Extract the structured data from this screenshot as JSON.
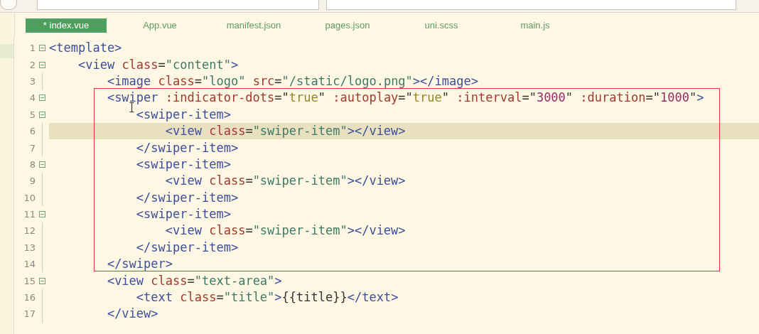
{
  "tabs": [
    {
      "label": "* index.vue",
      "selected": true
    },
    {
      "label": "App.vue",
      "selected": false
    },
    {
      "label": "manifest.json",
      "selected": false
    },
    {
      "label": "pages.json",
      "selected": false
    },
    {
      "label": "uni.scss",
      "selected": false
    },
    {
      "label": "main.js",
      "selected": false
    }
  ],
  "editor": {
    "lines": [
      {
        "number": "1",
        "kind": "open",
        "current": false,
        "tokens": [
          {
            "kind": "tag",
            "text": "<template>"
          }
        ]
      },
      {
        "number": "2",
        "kind": "open",
        "current": false,
        "tokens": [
          {
            "kind": "tag",
            "text": "    <view"
          },
          {
            "kind": "attr",
            "text": " class"
          },
          {
            "kind": "plain",
            "text": "="
          },
          {
            "kind": "str",
            "text": "\"content\""
          },
          {
            "kind": "tag",
            "text": ">"
          }
        ]
      },
      {
        "number": "3",
        "kind": "line",
        "current": false,
        "tokens": [
          {
            "kind": "tag",
            "text": "        <image"
          },
          {
            "kind": "attr",
            "text": " class"
          },
          {
            "kind": "plain",
            "text": "="
          },
          {
            "kind": "str",
            "text": "\"logo\""
          },
          {
            "kind": "attr",
            "text": " src"
          },
          {
            "kind": "plain",
            "text": "="
          },
          {
            "kind": "str",
            "text": "\"/static/logo.png\""
          },
          {
            "kind": "tag",
            "text": "></image>"
          }
        ]
      },
      {
        "number": "4",
        "kind": "open",
        "current": false,
        "tokens": [
          {
            "kind": "tag",
            "text": "        <swiper"
          },
          {
            "kind": "attr",
            "text": " :indicator-dots"
          },
          {
            "kind": "plain",
            "text": "=\""
          },
          {
            "kind": "bool",
            "text": "true"
          },
          {
            "kind": "plain",
            "text": "\" "
          },
          {
            "kind": "attr",
            "text": ":autoplay"
          },
          {
            "kind": "plain",
            "text": "=\""
          },
          {
            "kind": "bool",
            "text": "true"
          },
          {
            "kind": "plain",
            "text": "\" "
          },
          {
            "kind": "attr",
            "text": ":interval"
          },
          {
            "kind": "plain",
            "text": "=\""
          },
          {
            "kind": "num",
            "text": "3000"
          },
          {
            "kind": "plain",
            "text": "\" "
          },
          {
            "kind": "attr",
            "text": ":duration"
          },
          {
            "kind": "plain",
            "text": "=\""
          },
          {
            "kind": "num",
            "text": "1000"
          },
          {
            "kind": "plain",
            "text": "\""
          },
          {
            "kind": "tag",
            "text": ">"
          }
        ]
      },
      {
        "number": "5",
        "kind": "open",
        "current": false,
        "tokens": [
          {
            "kind": "tag",
            "text": "            <swiper-item>"
          }
        ]
      },
      {
        "number": "6",
        "kind": "line",
        "current": true,
        "tokens": [
          {
            "kind": "tag",
            "text": "                <view"
          },
          {
            "kind": "attr",
            "text": " class"
          },
          {
            "kind": "plain",
            "text": "="
          },
          {
            "kind": "str",
            "text": "\"swiper-item\""
          },
          {
            "kind": "tag",
            "text": "></view>"
          }
        ]
      },
      {
        "number": "7",
        "kind": "end",
        "current": false,
        "tokens": [
          {
            "kind": "tag",
            "text": "            </swiper-item>"
          }
        ]
      },
      {
        "number": "8",
        "kind": "open",
        "current": false,
        "tokens": [
          {
            "kind": "tag",
            "text": "            <swiper-item>"
          }
        ]
      },
      {
        "number": "9",
        "kind": "line",
        "current": false,
        "tokens": [
          {
            "kind": "tag",
            "text": "                <view"
          },
          {
            "kind": "attr",
            "text": " class"
          },
          {
            "kind": "plain",
            "text": "="
          },
          {
            "kind": "str",
            "text": "\"swiper-item\""
          },
          {
            "kind": "tag",
            "text": "></view>"
          }
        ]
      },
      {
        "number": "10",
        "kind": "end",
        "current": false,
        "tokens": [
          {
            "kind": "tag",
            "text": "            </swiper-item>"
          }
        ]
      },
      {
        "number": "11",
        "kind": "open",
        "current": false,
        "tokens": [
          {
            "kind": "tag",
            "text": "            <swiper-item>"
          }
        ]
      },
      {
        "number": "12",
        "kind": "line",
        "current": false,
        "tokens": [
          {
            "kind": "tag",
            "text": "                <view"
          },
          {
            "kind": "attr",
            "text": " class"
          },
          {
            "kind": "plain",
            "text": "="
          },
          {
            "kind": "str",
            "text": "\"swiper-item\""
          },
          {
            "kind": "tag",
            "text": "></view>"
          }
        ]
      },
      {
        "number": "13",
        "kind": "end",
        "current": false,
        "tokens": [
          {
            "kind": "tag",
            "text": "            </swiper-item>"
          }
        ]
      },
      {
        "number": "14",
        "kind": "end",
        "current": false,
        "tokens": [
          {
            "kind": "tag",
            "text": "        </swiper>"
          }
        ]
      },
      {
        "number": "15",
        "kind": "open",
        "current": false,
        "tokens": [
          {
            "kind": "tag",
            "text": "        <view"
          },
          {
            "kind": "attr",
            "text": " class"
          },
          {
            "kind": "plain",
            "text": "="
          },
          {
            "kind": "str",
            "text": "\"text-area\""
          },
          {
            "kind": "tag",
            "text": ">"
          }
        ]
      },
      {
        "number": "16",
        "kind": "line",
        "current": false,
        "tokens": [
          {
            "kind": "tag",
            "text": "            <text"
          },
          {
            "kind": "attr",
            "text": " class"
          },
          {
            "kind": "plain",
            "text": "="
          },
          {
            "kind": "str",
            "text": "\"title\""
          },
          {
            "kind": "tag",
            "text": ">"
          },
          {
            "kind": "plain",
            "text": "{{title}}"
          },
          {
            "kind": "tag",
            "text": "</text>"
          }
        ]
      },
      {
        "number": "17",
        "kind": "end",
        "current": false,
        "tokens": [
          {
            "kind": "tag",
            "text": "        </view>"
          }
        ]
      }
    ]
  }
}
